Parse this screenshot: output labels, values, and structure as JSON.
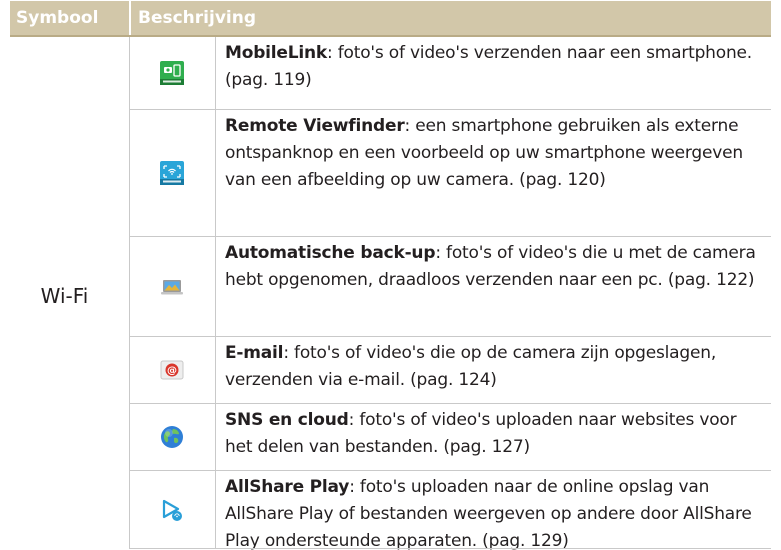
{
  "header": {
    "symbol_label": "Symbool",
    "description_label": "Beschrijving"
  },
  "category_label": "Wi-Fi",
  "rows": [
    {
      "icon": "mobilelink-icon",
      "title": "MobileLink",
      "text": ": foto's of video's verzenden naar een smartphone. (pag. 119)"
    },
    {
      "icon": "remote-viewfinder-icon",
      "title": "Remote Viewfinder",
      "text": ": een smartphone gebruiken als externe ontspanknop en een voorbeeld op uw smartphone weergeven van een afbeelding op uw camera. (pag. 120)"
    },
    {
      "icon": "auto-backup-icon",
      "title": "Automatische back-up",
      "text": ": foto's of video's die u met de camera hebt opgenomen, draadloos verzenden naar een pc. (pag. 122)"
    },
    {
      "icon": "email-icon",
      "title": "E-mail",
      "text": ": foto's of video's die op de camera zijn opgeslagen, verzenden via e-mail. (pag. 124)"
    },
    {
      "icon": "sns-cloud-icon",
      "title": "SNS en cloud",
      "text": ": foto's of video's uploaden naar websites voor het delen van bestanden. (pag. 127)"
    },
    {
      "icon": "allshare-play-icon",
      "title": "AllShare Play",
      "text": ": foto's uploaden naar de online opslag van AllShare Play of bestanden weergeven op andere door AllShare Play ondersteunde apparaten. (pag. 129)"
    }
  ],
  "colors": {
    "header_bg": "#d2c7a9",
    "header_text": "#ffffff",
    "rule": "#c9c9c9"
  }
}
